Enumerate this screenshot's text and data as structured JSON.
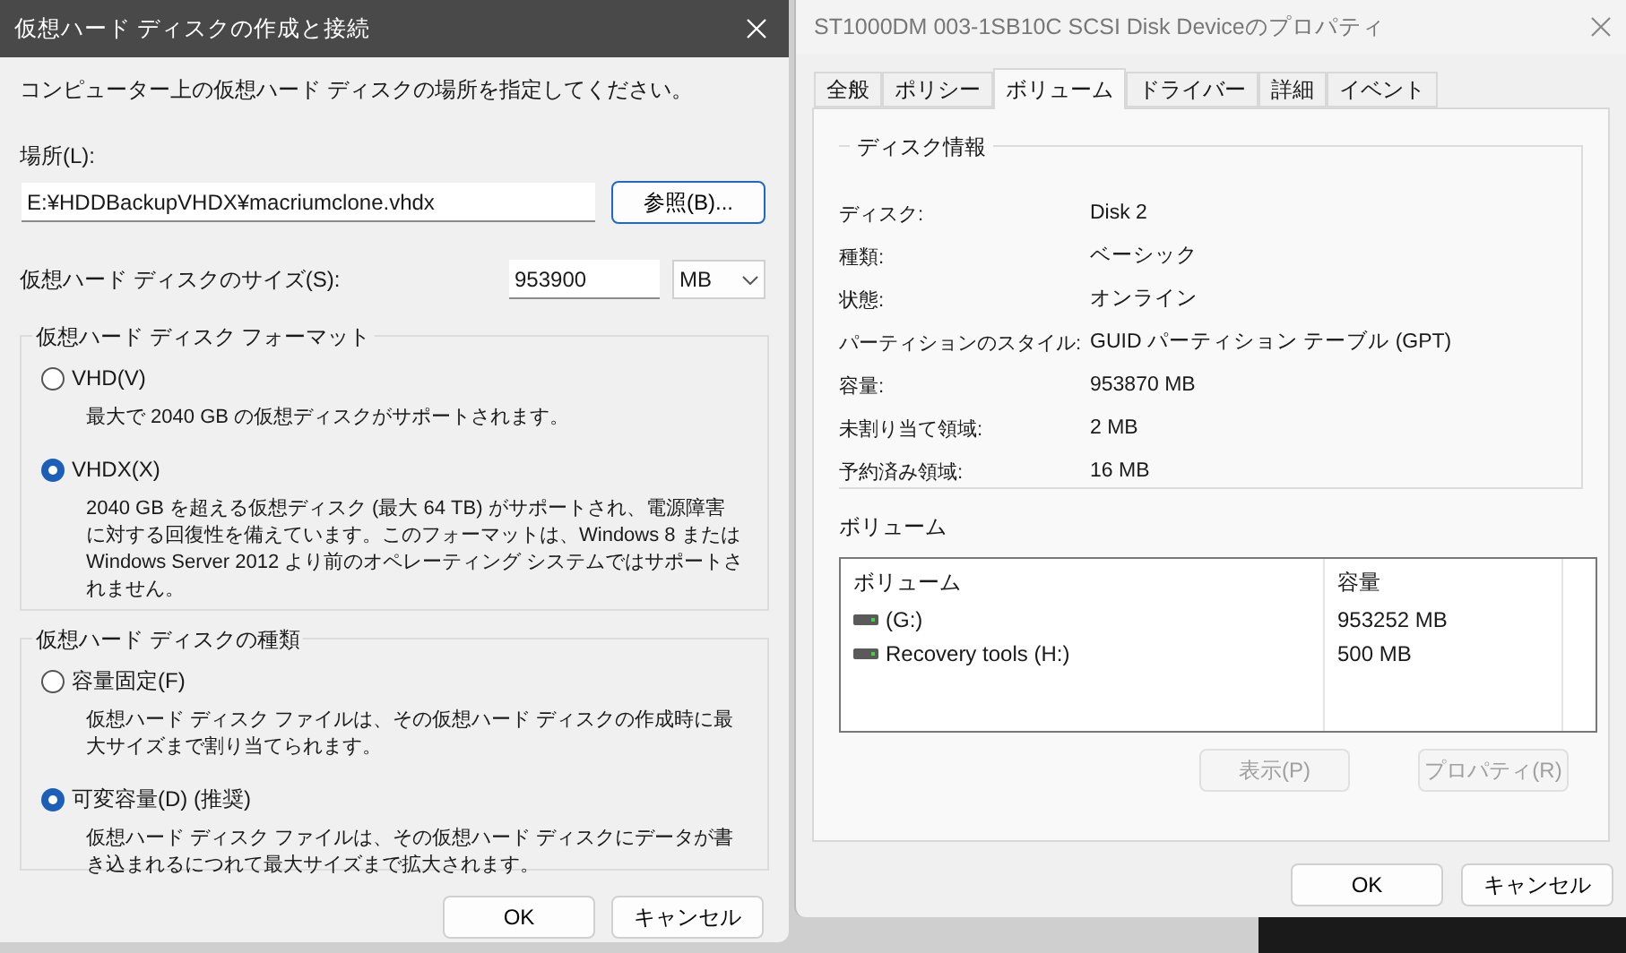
{
  "create_dialog": {
    "title": "仮想ハード ディスクの作成と接続",
    "instruction": "コンピューター上の仮想ハード ディスクの場所を指定してください。",
    "location": {
      "label": "場所(L):",
      "value": "E:¥HDDBackupVHDX¥macriumclone.vhdx",
      "browse_button": "参照(B)..."
    },
    "size": {
      "label": "仮想ハード ディスクのサイズ(S):",
      "value": "953900",
      "unit": "MB"
    },
    "format_group": {
      "title": "仮想ハード ディスク フォーマット",
      "options": [
        {
          "label": "VHD(V)",
          "selected": false,
          "description": "最大で 2040 GB の仮想ディスクがサポートされます。"
        },
        {
          "label": "VHDX(X)",
          "selected": true,
          "description": "2040 GB を超える仮想ディスク (最大 64 TB) がサポートされ、電源障害に対する回復性を備えています。このフォーマットは、Windows 8 または Windows Server 2012 より前のオペレーティング システムではサポートされません。"
        }
      ]
    },
    "type_group": {
      "title": "仮想ハード ディスクの種類",
      "options": [
        {
          "label": "容量固定(F)",
          "selected": false,
          "description": "仮想ハード ディスク ファイルは、その仮想ハード ディスクの作成時に最大サイズまで割り当てられます。"
        },
        {
          "label": "可変容量(D) (推奨)",
          "selected": true,
          "description": "仮想ハード ディスク ファイルは、その仮想ハード ディスクにデータが書き込まれるにつれて最大サイズまで拡大されます。"
        }
      ]
    },
    "buttons": [
      "OK",
      "キャンセル"
    ]
  },
  "properties_window": {
    "title": "ST1000DM 003-1SB10C SCSI Disk Deviceのプロパティ",
    "tabs": [
      {
        "label": "全般",
        "selected": false
      },
      {
        "label": "ポリシー",
        "selected": false
      },
      {
        "label": "ボリューム",
        "selected": true
      },
      {
        "label": "ドライバー",
        "selected": false
      },
      {
        "label": "詳細",
        "selected": false
      },
      {
        "label": "イベント",
        "selected": false
      }
    ],
    "disk_info": {
      "title": "ディスク情報",
      "rows": [
        {
          "label": "ディスク:",
          "value": "Disk 2"
        },
        {
          "label": "種類:",
          "value": "ベーシック"
        },
        {
          "label": "状態:",
          "value": "オンライン"
        },
        {
          "label": "パーティションのスタイル:",
          "value": "GUID パーティション テーブル (GPT)"
        },
        {
          "label": "容量:",
          "value": "953870 MB"
        },
        {
          "label": "未割り当て領域:",
          "value": "2 MB"
        },
        {
          "label": "予約済み領域:",
          "value": "16 MB"
        }
      ]
    },
    "volumes": {
      "title": "ボリューム",
      "columns": [
        "ボリューム",
        "容量"
      ],
      "rows": [
        {
          "name": "(G:)",
          "capacity": "953252 MB"
        },
        {
          "name": "Recovery tools (H:)",
          "capacity": "500 MB"
        }
      ]
    },
    "volume_buttons": [
      {
        "label": "表示(P)",
        "disabled": true
      },
      {
        "label": "プロパティ(R)",
        "disabled": true
      }
    ],
    "buttons": [
      "OK",
      "キャンセル"
    ]
  }
}
